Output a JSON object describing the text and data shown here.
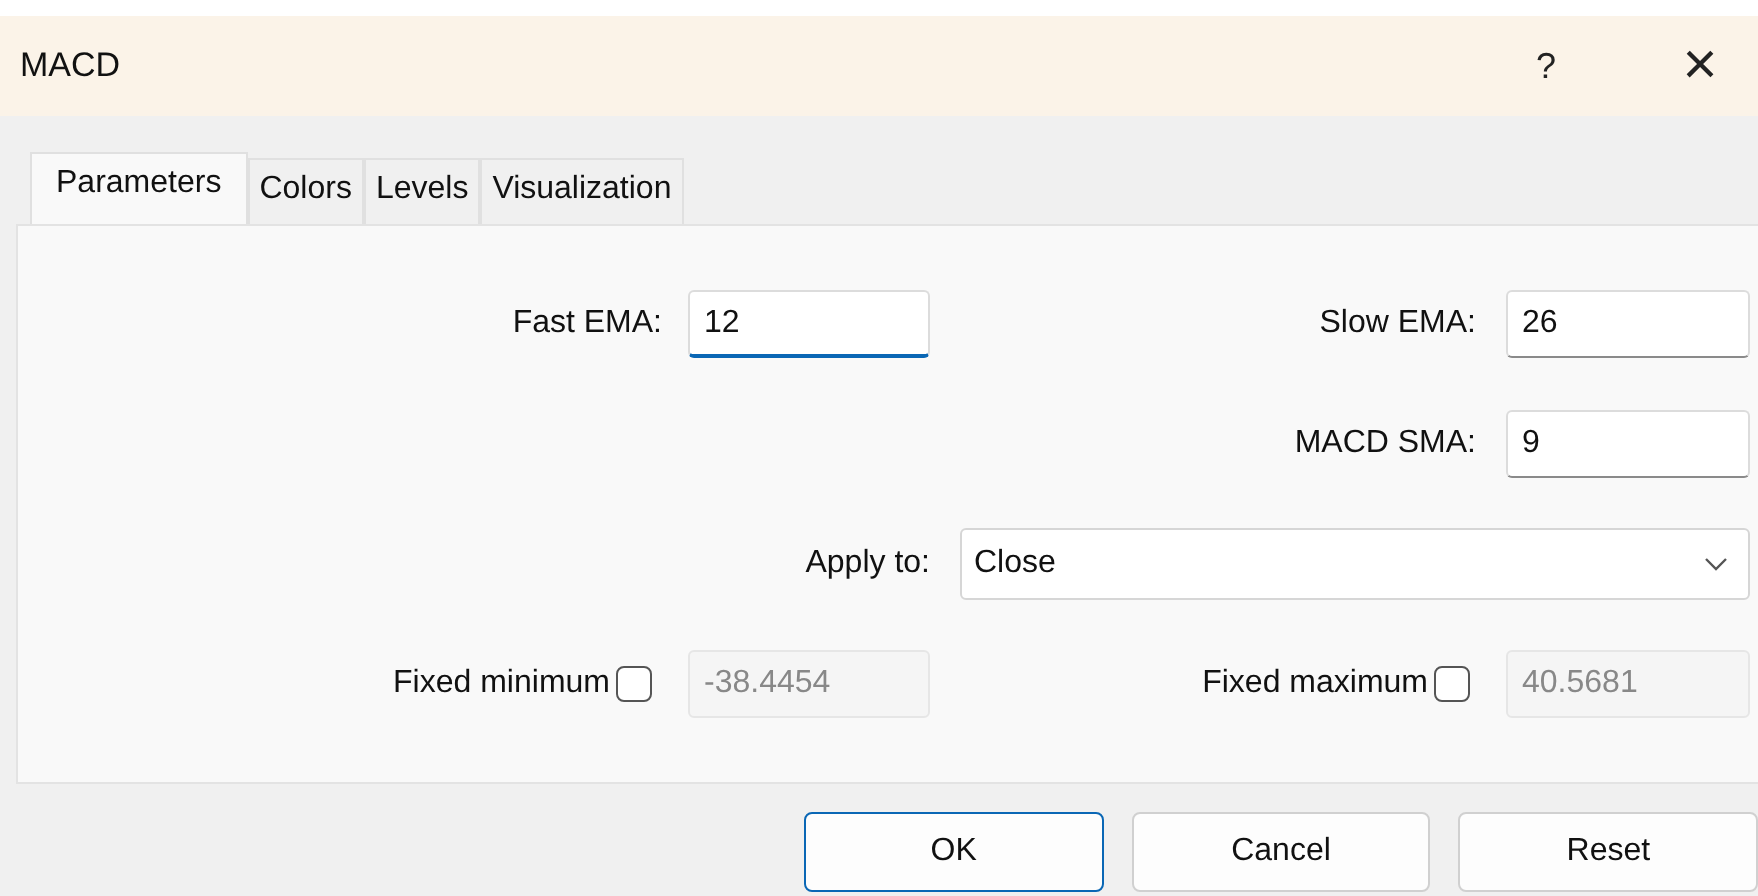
{
  "window": {
    "title": "MACD",
    "help": "?",
    "close": "×"
  },
  "tabs": [
    {
      "label": "Parameters",
      "selected": true
    },
    {
      "label": "Colors",
      "selected": false
    },
    {
      "label": "Levels",
      "selected": false
    },
    {
      "label": "Visualization",
      "selected": false
    }
  ],
  "fast_ema": {
    "label": "Fast EMA:",
    "value": "12",
    "focused": true
  },
  "slow_ema": {
    "label": "Slow EMA:",
    "value": "26",
    "focused": false
  },
  "macd_sma": {
    "label": "MACD SMA:",
    "value": "9",
    "focused": false
  },
  "apply_to": {
    "label": "Apply to:",
    "value": "Close"
  },
  "fixed_minimum": {
    "label": "Fixed minimum",
    "checked": false,
    "value": "-38.4454",
    "disabled": true
  },
  "fixed_maximum": {
    "label": "Fixed maximum",
    "checked": false,
    "value": "40.5681",
    "disabled": true
  },
  "buttons": [
    {
      "label": "OK",
      "default": true
    },
    {
      "label": "Cancel",
      "default": false
    },
    {
      "label": "Reset",
      "default": false
    }
  ]
}
